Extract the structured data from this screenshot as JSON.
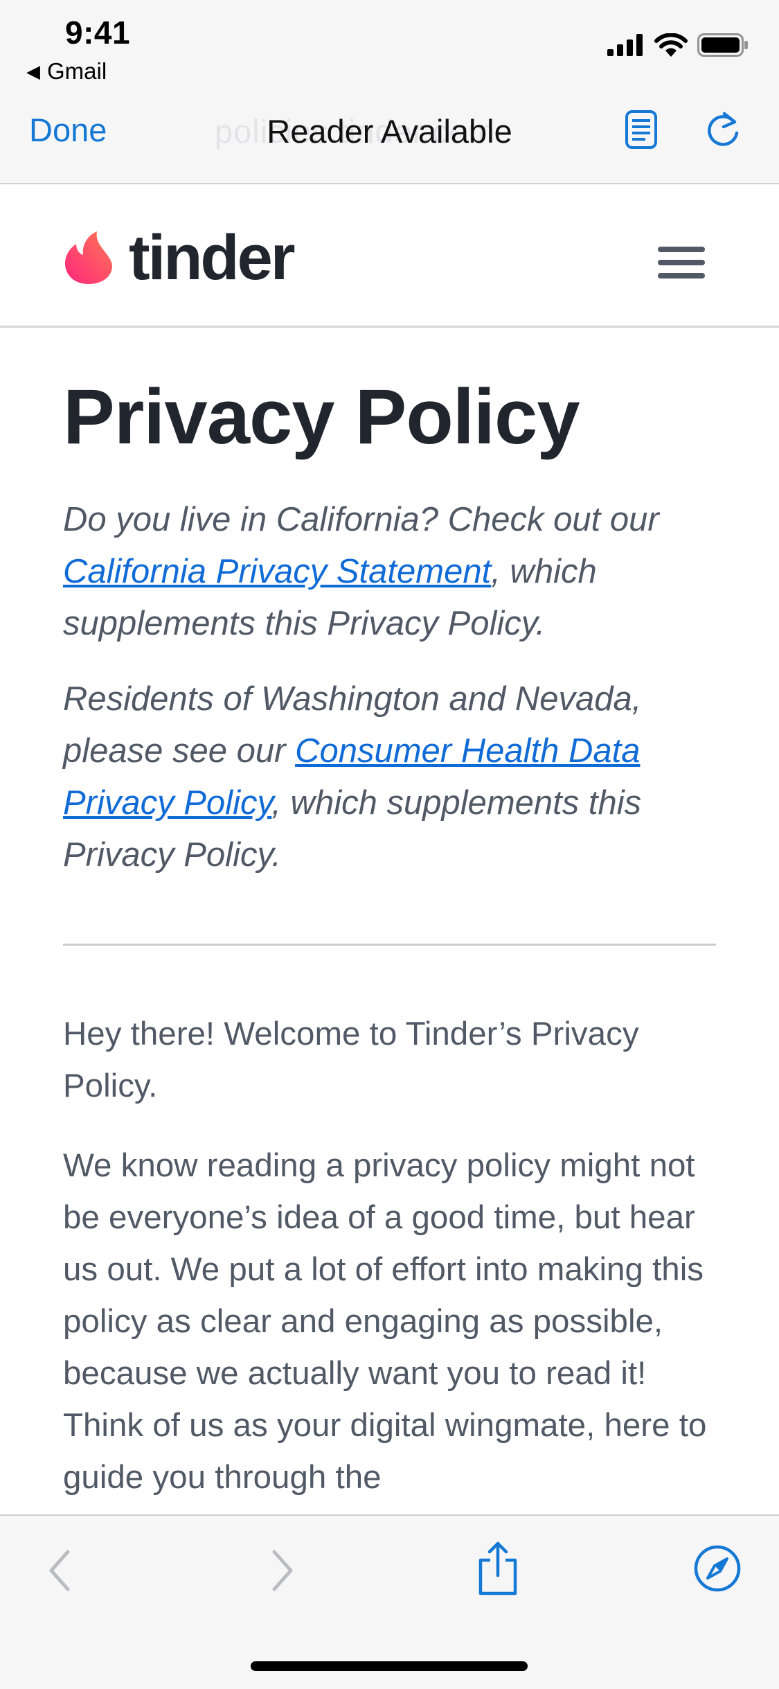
{
  "status_bar": {
    "time": "9:41",
    "back_label": "Gmail",
    "icons": [
      "signal-icon",
      "wifi-icon",
      "battery-icon"
    ]
  },
  "browser": {
    "done_label": "Done",
    "reader_text": "Reader Available",
    "url_ghost": "policies.tinder.com",
    "icons": [
      "reader-icon",
      "reload-icon"
    ],
    "accent_color": "#1478d4"
  },
  "site_header": {
    "logo_text": "tinder",
    "icons": [
      "tinder-flame-icon",
      "hamburger-menu-icon"
    ],
    "brand_colors": [
      "#fd267d",
      "#ff7854"
    ]
  },
  "main": {
    "title": "Privacy Policy",
    "notice1": {
      "prefix": "Do you live in California? Check out our ",
      "link": "California Privacy Statement",
      "suffix": ", which supplements this Privacy Policy."
    },
    "notice2": {
      "prefix": "Residents of Washington and Nevada, please see our ",
      "link": "Consumer Health Data Privacy Policy",
      "suffix": ", which supplements this Privacy Policy."
    },
    "intro": "Hey there! Welcome to Tinder’s Privacy Policy.",
    "body": "We know reading a privacy policy might not be everyone’s idea of a good time, but hear us out. We put a lot of effort into making this policy as clear and engaging as possible, because we actually want you to read it! Think of us as your digital wingmate, here to guide you through the"
  },
  "toolbar": {
    "icons": [
      "back-chevron-icon",
      "forward-chevron-icon",
      "share-icon",
      "compass-icon"
    ]
  }
}
